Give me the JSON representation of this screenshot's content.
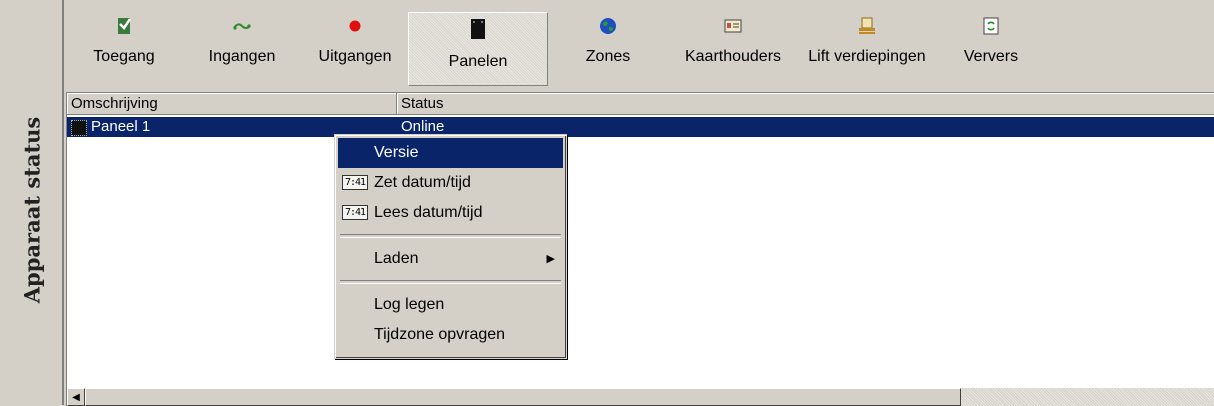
{
  "sidebar": {
    "title": "Apparaat status"
  },
  "toolbar": {
    "items": [
      {
        "label": "Toegang",
        "icon": "toegang-icon"
      },
      {
        "label": "Ingangen",
        "icon": "ingangen-icon"
      },
      {
        "label": "Uitgangen",
        "icon": "uitgangen-icon"
      },
      {
        "label": "Panelen",
        "icon": "panelen-icon",
        "active": true
      },
      {
        "label": "Zones",
        "icon": "zones-icon"
      },
      {
        "label": "Kaarthouders",
        "icon": "kaarthouders-icon"
      },
      {
        "label": "Lift verdiepingen",
        "icon": "lift-verdiepingen-icon"
      },
      {
        "label": "Ververs",
        "icon": "ververs-icon"
      }
    ]
  },
  "list": {
    "columns": [
      "Omschrijving",
      "Status"
    ],
    "rows": [
      {
        "description": "Paneel 1",
        "status": "Online"
      }
    ]
  },
  "context_menu": {
    "items": {
      "versie": "Versie",
      "zet_datum": "Zet datum/tijd",
      "lees_datum": "Lees datum/tijd",
      "laden": "Laden",
      "log_legen": "Log legen",
      "tijdzone": "Tijdzone opvragen"
    },
    "clock_icon_text": "7:41"
  },
  "colors": {
    "selection": "#0a246a",
    "window_face": "#d4d0c8"
  }
}
